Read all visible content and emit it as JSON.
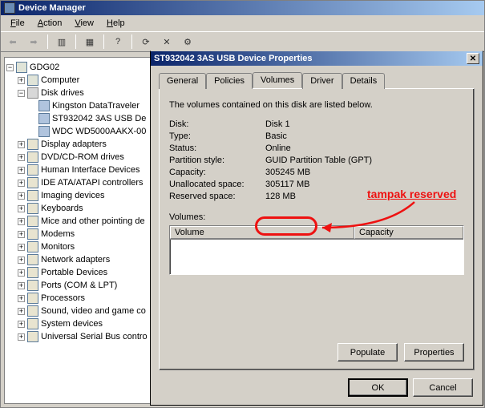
{
  "window": {
    "title": "Device Manager"
  },
  "menu": {
    "file": "File",
    "action": "Action",
    "view": "View",
    "help": "Help"
  },
  "tree": {
    "root": "GDG02",
    "computer": "Computer",
    "disk_drives": "Disk drives",
    "drives": {
      "d0": "Kingston DataTraveler",
      "d1": "ST932042 3AS USB De",
      "d2": "WDC WD5000AAKX-00"
    },
    "items": {
      "display": "Display adapters",
      "dvd": "DVD/CD-ROM drives",
      "hid": "Human Interface Devices",
      "ide": "IDE ATA/ATAPI controllers",
      "imaging": "Imaging devices",
      "keyboards": "Keyboards",
      "mice": "Mice and other pointing de",
      "modems": "Modems",
      "monitors": "Monitors",
      "network": "Network adapters",
      "portable": "Portable Devices",
      "ports": "Ports (COM & LPT)",
      "processors": "Processors",
      "sound": "Sound, video and game co",
      "system": "System devices",
      "usb": "Universal Serial Bus contro"
    }
  },
  "dialog": {
    "title": "ST932042 3AS USB Device Properties",
    "tabs": {
      "general": "General",
      "policies": "Policies",
      "volumes": "Volumes",
      "driver": "Driver",
      "details": "Details"
    },
    "desc": "The volumes contained on this disk are listed below.",
    "fields": {
      "disk_l": "Disk:",
      "disk_v": "Disk 1",
      "type_l": "Type:",
      "type_v": "Basic",
      "status_l": "Status:",
      "status_v": "Online",
      "partition_l": "Partition style:",
      "partition_v": "GUID Partition Table (GPT)",
      "capacity_l": "Capacity:",
      "capacity_v": "305245 MB",
      "unalloc_l": "Unallocated space:",
      "unalloc_v": "305117 MB",
      "reserved_l": "Reserved space:",
      "reserved_v": "128 MB"
    },
    "vol_section": "Volumes:",
    "vol_cols": {
      "volume": "Volume",
      "capacity": "Capacity"
    },
    "buttons": {
      "populate": "Populate",
      "properties": "Properties",
      "ok": "OK",
      "cancel": "Cancel"
    }
  },
  "annotation": {
    "text": "tampak reserved"
  }
}
